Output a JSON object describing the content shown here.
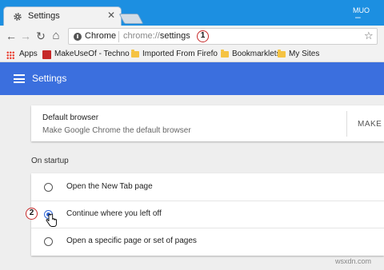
{
  "window": {
    "tab_title": "Settings",
    "tab_close": "✕",
    "profile": "MUO",
    "minimize": "–"
  },
  "toolbar": {
    "back": "←",
    "forward": "→",
    "reload": "↻",
    "home": "⌂",
    "chip": "Chrome",
    "url_scheme": "chrome://",
    "url_host": "settings",
    "star": "☆",
    "marker_1": "1"
  },
  "bookmarks": {
    "items": [
      {
        "label": "Apps"
      },
      {
        "label": "MakeUseOf - Techno"
      },
      {
        "label": "Imported From Firefo"
      },
      {
        "label": "Bookmarklets"
      },
      {
        "label": "My Sites"
      }
    ]
  },
  "header": {
    "title": "Settings"
  },
  "default_browser": {
    "title": "Default browser",
    "subtitle": "Make Google Chrome the default browser",
    "button": "MAKE D"
  },
  "startup": {
    "label": "On startup",
    "marker_2": "2",
    "options": [
      {
        "label": "Open the New Tab page",
        "selected": false
      },
      {
        "label": "Continue where you left off",
        "selected": true
      },
      {
        "label": "Open a specific page or set of pages",
        "selected": false
      }
    ]
  },
  "watermark": "wsxdn.com",
  "colors": {
    "titlebar": "#1c8fe1",
    "header": "#3b6fde",
    "accent": "#3367d6",
    "marker": "#c62828"
  }
}
